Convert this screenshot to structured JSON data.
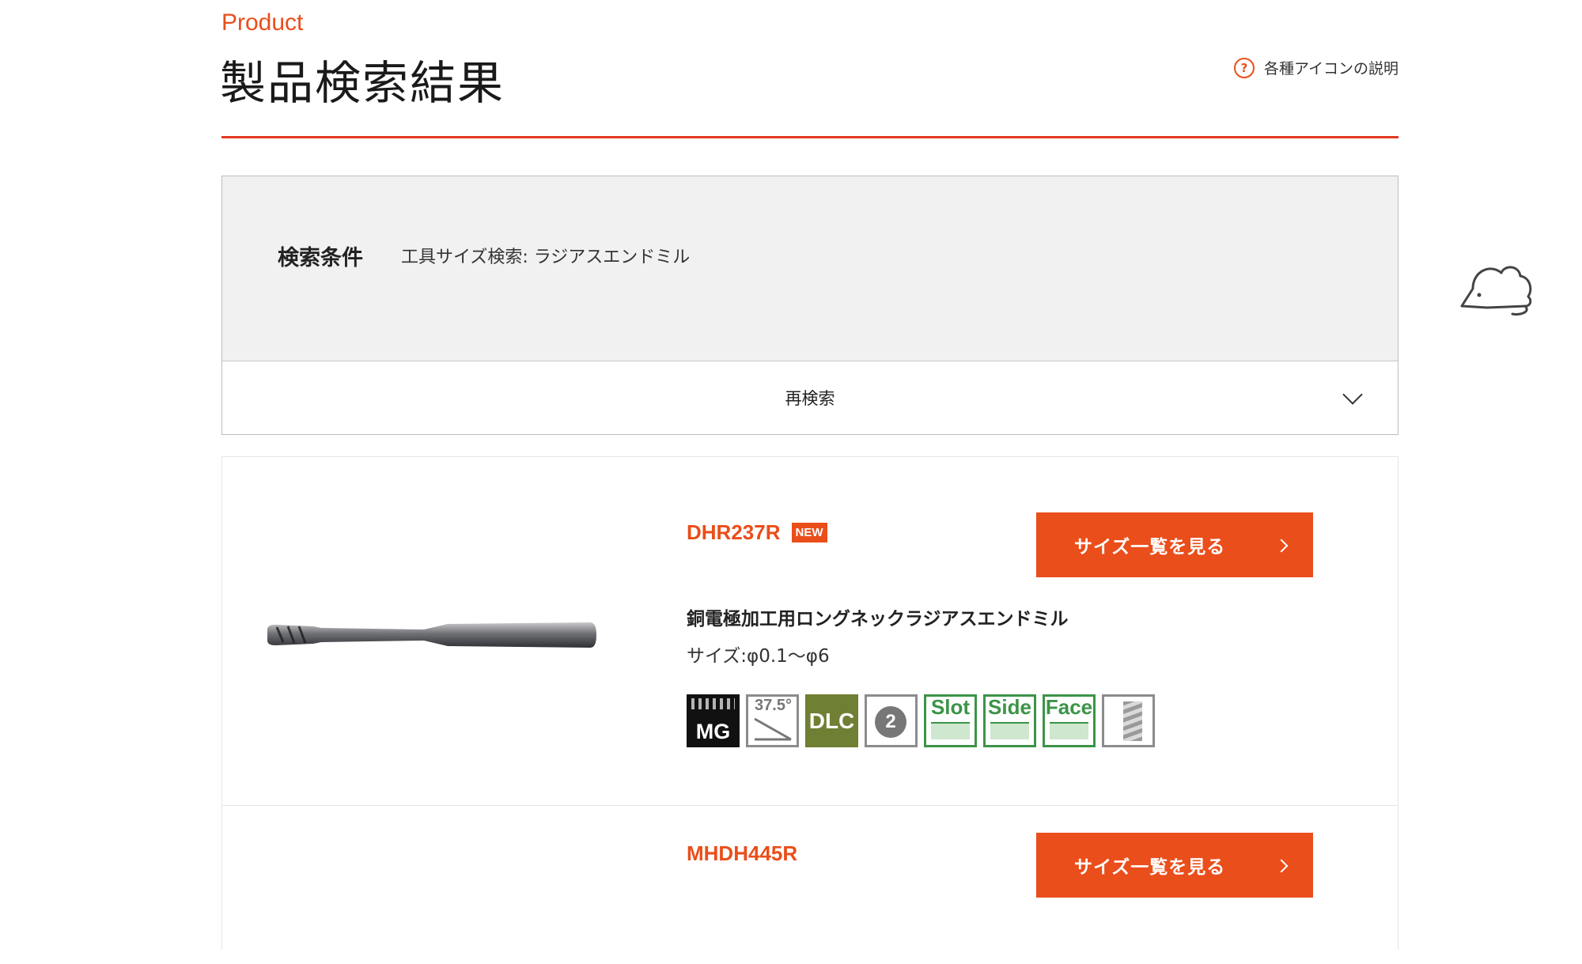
{
  "header": {
    "eyebrow": "Product",
    "title": "製品検索結果",
    "help_link": "各種アイコンの説明",
    "help_icon_glyph": "?"
  },
  "search": {
    "criteria_label": "検索条件",
    "criteria_value": "工具サイズ検索: ラジアスエンドミル",
    "research_label": "再検索"
  },
  "products": [
    {
      "code": "DHR237R",
      "badge": "NEW",
      "button_label": "サイズ一覧を見る",
      "description": "銅電極加工用ロングネックラジアスエンドミル",
      "size": "サイズ:φ0.1〜φ6",
      "feature_icons": [
        {
          "name": "mg-icon",
          "text": "MG"
        },
        {
          "name": "helix-angle-icon",
          "text": "37.5°"
        },
        {
          "name": "dlc-icon",
          "text": "DLC"
        },
        {
          "name": "two-flute-icon",
          "text": "2"
        },
        {
          "name": "slot-icon",
          "text": "Slot"
        },
        {
          "name": "side-icon",
          "text": "Side"
        },
        {
          "name": "face-icon",
          "text": "Face"
        },
        {
          "name": "coolant-icon",
          "text": ""
        }
      ]
    },
    {
      "code": "MHDH445R",
      "button_label": "サイズ一覧を見る"
    }
  ],
  "colors": {
    "accent": "#ea4e1b",
    "rule": "#e23a21",
    "panel_bg": "#f1f1f1",
    "dlc_green": "#6f7f33",
    "cut_green": "#3c9448"
  }
}
